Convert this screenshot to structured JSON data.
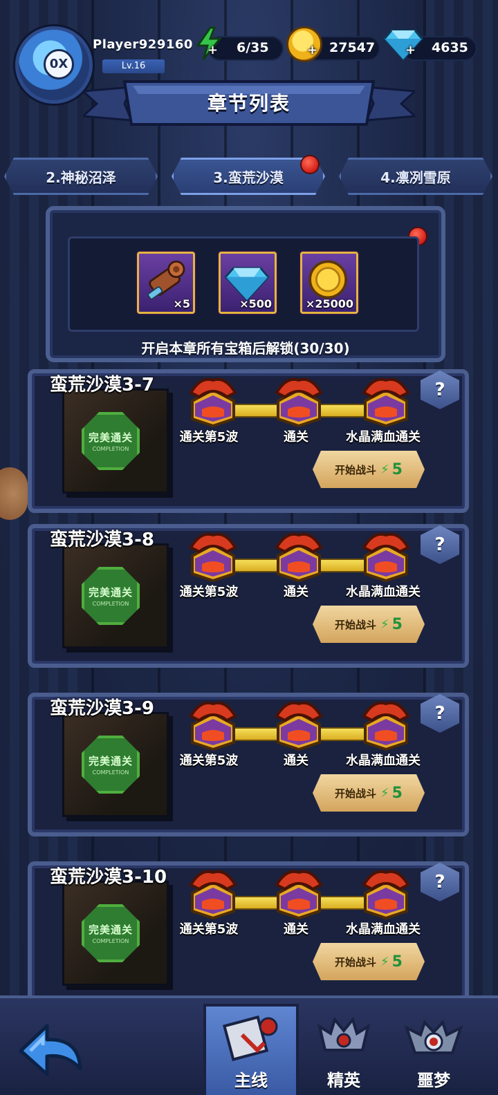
{
  "header": {
    "player_name": "Player929160",
    "level": "Lv.16",
    "avatar_badge": "0X",
    "energy": "6/35",
    "coins": "27547",
    "gems": "4635",
    "plus": "+"
  },
  "banner": {
    "title": "章节列表"
  },
  "chapters": [
    {
      "label": "2.神秘沼泽"
    },
    {
      "label": "3.蛮荒沙漠",
      "active": true,
      "has_notice": true
    },
    {
      "label": "4.凛冽雪原"
    }
  ],
  "chapter_rewards": {
    "items": [
      {
        "icon": "scroll-icon",
        "qty": "×5"
      },
      {
        "icon": "gem-icon",
        "qty": "×500"
      },
      {
        "icon": "coin-icon",
        "qty": "×25000"
      }
    ],
    "caption": "开启本章所有宝箱后解锁(30/30)"
  },
  "levels": [
    {
      "title": "蛮荒沙漠3-7",
      "objectives": [
        "通关第5波",
        "通关",
        "水晶满血通关"
      ],
      "completion_seal": "完美通关",
      "completion_sub": "COMPLETION",
      "battle_label": "开始战斗",
      "battle_cost": "5"
    },
    {
      "title": "蛮荒沙漠3-8",
      "objectives": [
        "通关第5波",
        "通关",
        "水晶满血通关"
      ],
      "completion_seal": "完美通关",
      "completion_sub": "COMPLETION",
      "battle_label": "开始战斗",
      "battle_cost": "5"
    },
    {
      "title": "蛮荒沙漠3-9",
      "objectives": [
        "通关第5波",
        "通关",
        "水晶满血通关"
      ],
      "completion_seal": "完美通关",
      "completion_sub": "COMPLETION",
      "battle_label": "开始战斗",
      "battle_cost": "5"
    },
    {
      "title": "蛮荒沙漠3-10",
      "objectives": [
        "通关第5波",
        "通关",
        "水晶满血通关"
      ],
      "completion_seal": "完美通关",
      "completion_sub": "COMPLETION",
      "battle_label": "开始战斗",
      "battle_cost": "5"
    }
  ],
  "help_symbol": "?",
  "bottom_nav": [
    {
      "label": "主线",
      "icon": "main-story-icon",
      "active": true
    },
    {
      "label": "精英",
      "icon": "elite-icon"
    },
    {
      "label": "噩梦",
      "icon": "nightmare-icon"
    }
  ],
  "colors": {
    "energy": "#2cae3b",
    "coin": "#f0b21a",
    "gem": "#4fc3f0",
    "notice": "#d21f17",
    "track": "#f6de5a"
  }
}
